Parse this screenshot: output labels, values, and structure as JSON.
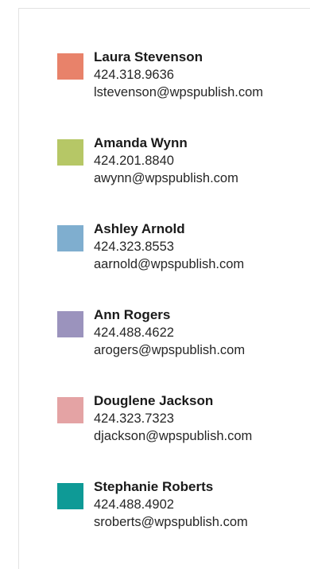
{
  "contacts": [
    {
      "name": "Laura Stevenson",
      "phone": "424.318.9636",
      "email": "lstevenson@wpspublish.com",
      "color": "#e8826a"
    },
    {
      "name": "Amanda Wynn",
      "phone": "424.201.8840",
      "email": "awynn@wpspublish.com",
      "color": "#b6c766"
    },
    {
      "name": "Ashley Arnold",
      "phone": "424.323.8553",
      "email": "aarnold@wpspublish.com",
      "color": "#7faecf"
    },
    {
      "name": "Ann Rogers",
      "phone": "424.488.4622",
      "email": "arogers@wpspublish.com",
      "color": "#9b93bd"
    },
    {
      "name": "Douglene Jackson",
      "phone": "424.323.7323",
      "email": "djackson@wpspublish.com",
      "color": "#e4a3a4"
    },
    {
      "name": "Stephanie Roberts",
      "phone": "424.488.4902",
      "email": "sroberts@wpspublish.com",
      "color": "#0e9a96"
    }
  ]
}
